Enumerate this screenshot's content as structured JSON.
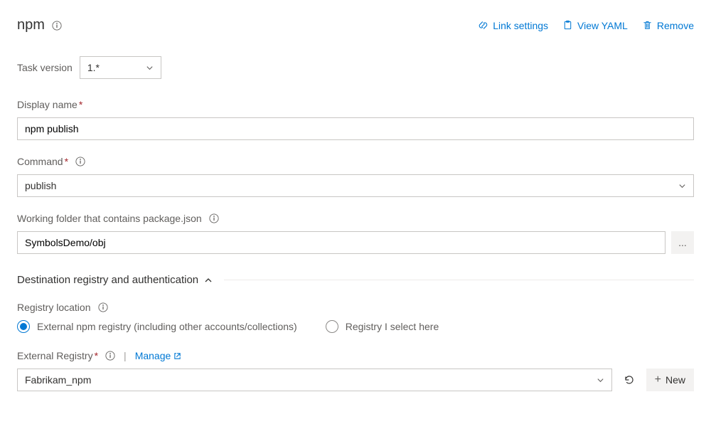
{
  "header": {
    "title": "npm",
    "actions": {
      "link_settings": "Link settings",
      "view_yaml": "View YAML",
      "remove": "Remove"
    }
  },
  "task_version": {
    "label": "Task version",
    "value": "1.*"
  },
  "display_name": {
    "label": "Display name",
    "value": "npm publish"
  },
  "command": {
    "label": "Command",
    "value": "publish"
  },
  "working_folder": {
    "label": "Working folder that contains package.json",
    "value": "SymbolsDemo/obj"
  },
  "section": {
    "title": "Destination registry and authentication"
  },
  "registry_location": {
    "label": "Registry location",
    "options": {
      "external": "External npm registry (including other accounts/collections)",
      "select_here": "Registry I select here"
    },
    "selected": "external"
  },
  "external_registry": {
    "label": "External Registry",
    "manage": "Manage",
    "value": "Fabrikam_npm",
    "new_button": "New"
  },
  "icons": {
    "ellipsis": "...",
    "plus": "+"
  }
}
